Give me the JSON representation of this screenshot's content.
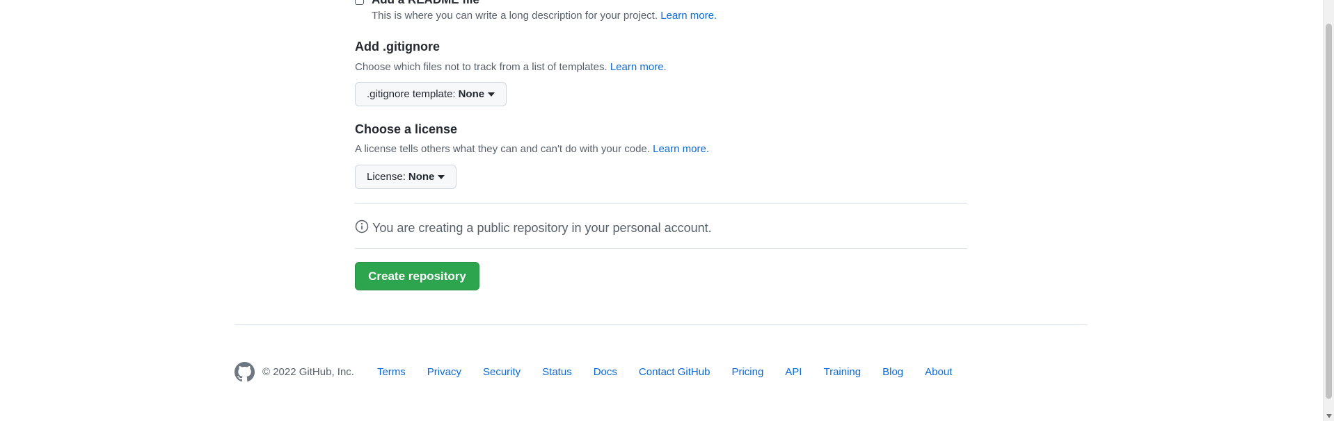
{
  "readme": {
    "label": "Add a README file",
    "note": "This is where you can write a long description for your project.",
    "link": "Learn more."
  },
  "gitignore": {
    "title": "Add .gitignore",
    "note": "Choose which files not to track from a list of templates.",
    "link": "Learn more.",
    "select_label": ".gitignore template:",
    "select_value": "None"
  },
  "license": {
    "title": "Choose a license",
    "note": "A license tells others what they can and can't do with your code.",
    "link": "Learn more.",
    "select_label": "License:",
    "select_value": "None"
  },
  "info": {
    "icon": "info-icon",
    "text": "You are creating a public repository in your personal account."
  },
  "create_button": "Create repository",
  "footer": {
    "logo_icon": "github-logo-icon",
    "copyright": "© 2022 GitHub, Inc.",
    "links": [
      "Terms",
      "Privacy",
      "Security",
      "Status",
      "Docs",
      "Contact GitHub",
      "Pricing",
      "API",
      "Training",
      "Blog",
      "About"
    ]
  },
  "colors": {
    "primary_button": "#2da44e",
    "link": "#0969da",
    "muted_text": "#57606a"
  }
}
